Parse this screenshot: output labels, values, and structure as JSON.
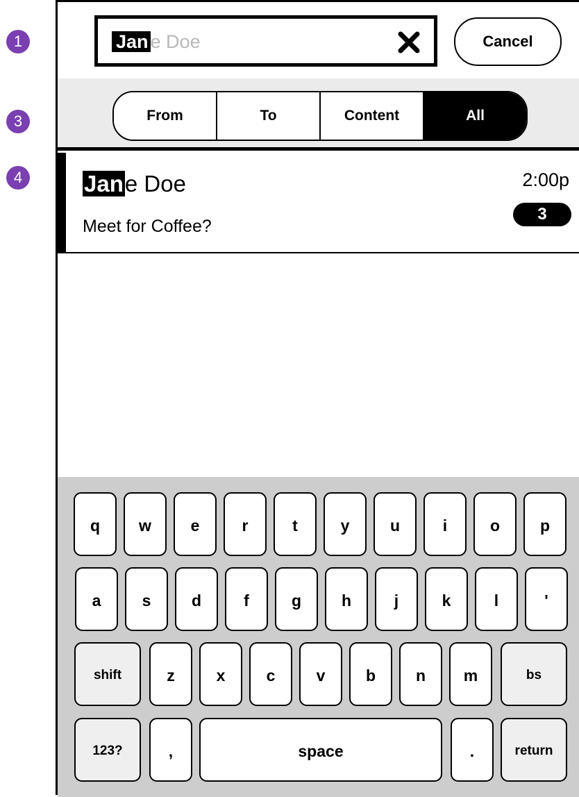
{
  "annotations": [
    "1",
    "3",
    "4"
  ],
  "search": {
    "typed": "Jan",
    "suggestion_rest": "e Doe",
    "clear_icon": "close-icon",
    "cancel_label": "Cancel"
  },
  "filters": {
    "items": [
      "From",
      "To",
      "Content",
      "All"
    ],
    "selected": "All"
  },
  "results": [
    {
      "name_match": "Jan",
      "name_rest": "e Doe",
      "preview": "Meet for Coffee?",
      "time": "2:00p",
      "count": "3"
    }
  ],
  "keyboard": {
    "row1": [
      "q",
      "w",
      "e",
      "r",
      "t",
      "y",
      "u",
      "i",
      "o",
      "p"
    ],
    "row2": [
      "a",
      "s",
      "d",
      "f",
      "g",
      "h",
      "j",
      "k",
      "l",
      "'"
    ],
    "row3": [
      "shift",
      "z",
      "x",
      "c",
      "v",
      "b",
      "n",
      "m",
      "bs"
    ],
    "row4": [
      "123?",
      ",",
      "space",
      ".",
      "return"
    ]
  },
  "colors": {
    "annotation": "#7a3fb0",
    "filter_bar_bg": "#ebebeb",
    "keyboard_bg": "#cdcdcd",
    "highlight": "#000000"
  }
}
